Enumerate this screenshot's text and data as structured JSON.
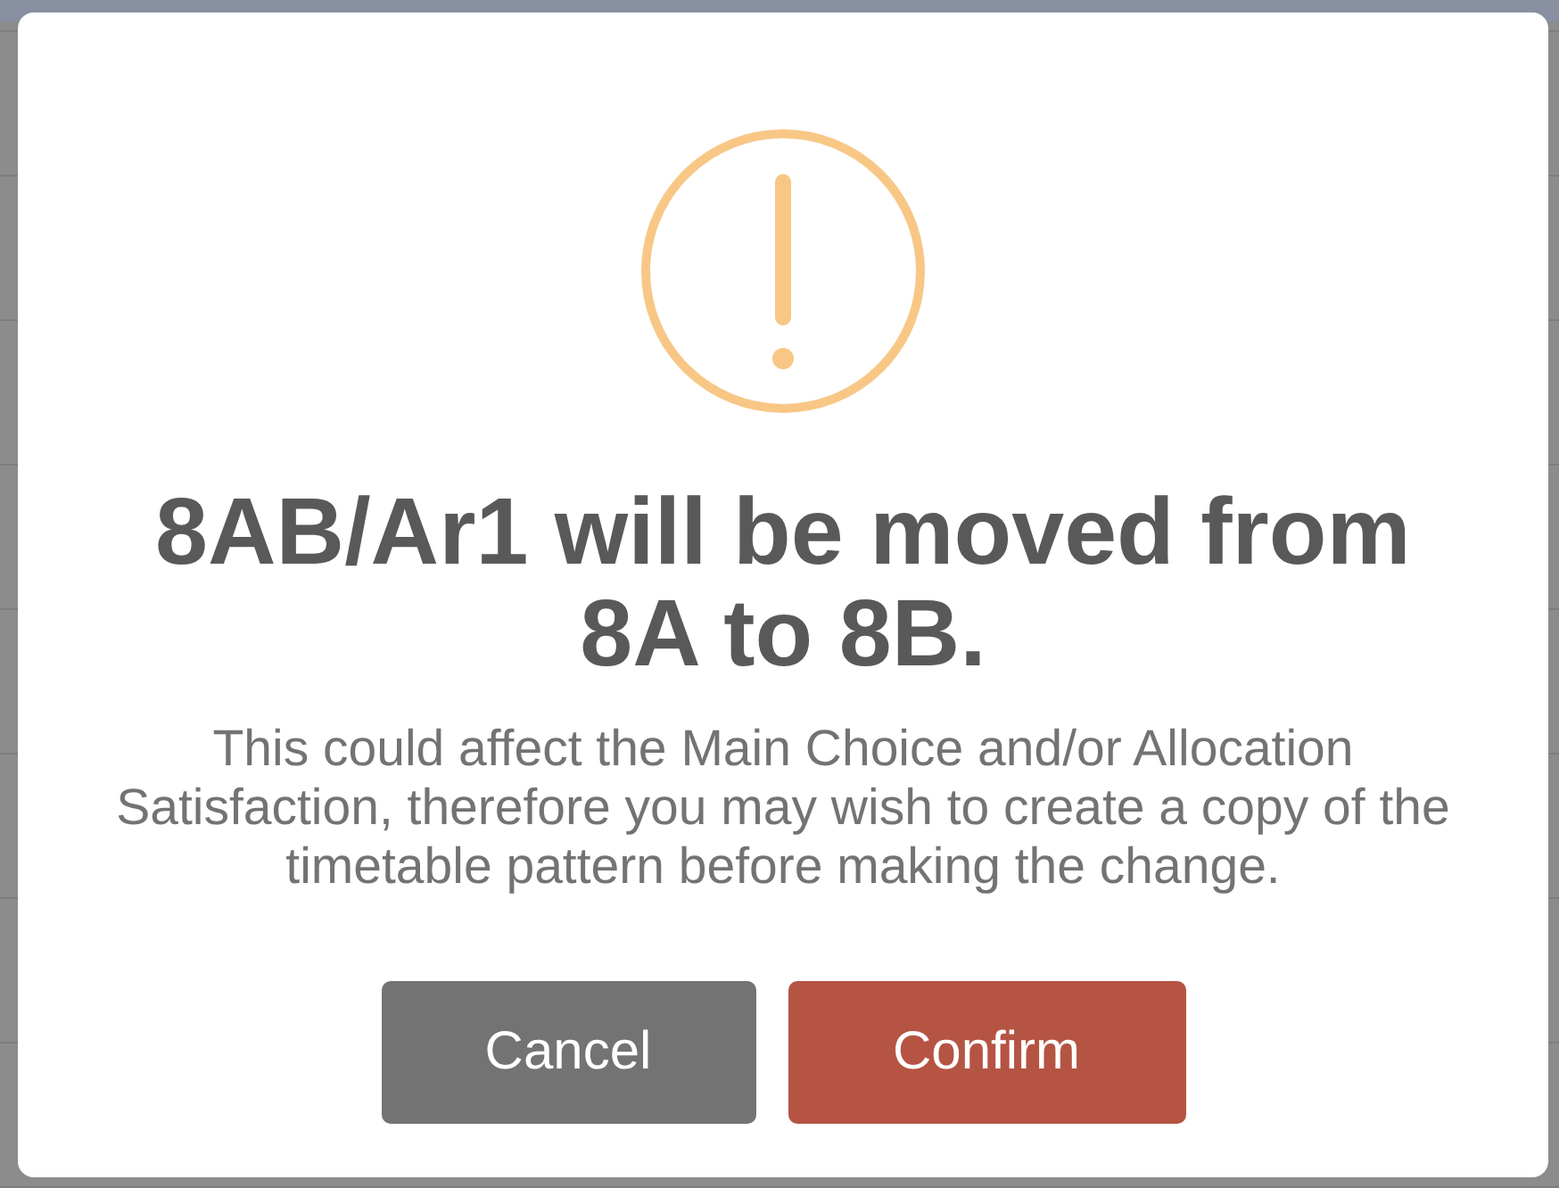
{
  "dialog": {
    "title": "8AB/Ar1 will be moved from 8A to 8B.",
    "message": "This could affect the Main Choice and/or Allocation Satisfaction, therefore you may wish to create a copy of the timetable pattern before making the change.",
    "buttons": [
      {
        "label": "Cancel",
        "kind": "cancel"
      },
      {
        "label": "Confirm",
        "kind": "confirm"
      }
    ]
  }
}
